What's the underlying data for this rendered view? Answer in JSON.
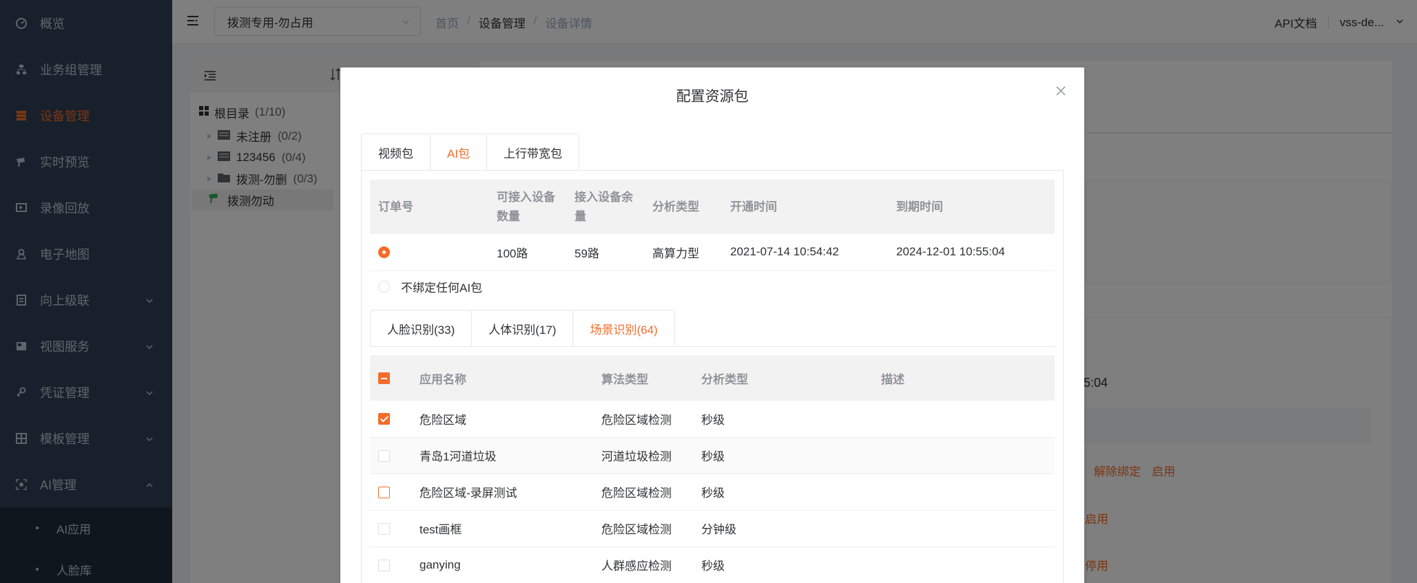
{
  "sidebar": {
    "items": [
      {
        "label": "概览",
        "icon": "dashboard-icon"
      },
      {
        "label": "业务组管理",
        "icon": "org-icon"
      },
      {
        "label": "设备管理",
        "icon": "device-icon",
        "active": true
      },
      {
        "label": "实时预览",
        "icon": "camera-icon"
      },
      {
        "label": "录像回放",
        "icon": "playback-icon"
      },
      {
        "label": "电子地图",
        "icon": "map-icon"
      },
      {
        "label": "向上级联",
        "icon": "cascade-icon",
        "expandable": true
      },
      {
        "label": "视图服务",
        "icon": "view-icon",
        "expandable": true
      },
      {
        "label": "凭证管理",
        "icon": "key-icon",
        "expandable": true
      },
      {
        "label": "模板管理",
        "icon": "template-icon",
        "expandable": true
      },
      {
        "label": "AI管理",
        "icon": "ai-icon",
        "expanded": true
      }
    ],
    "subitems": [
      {
        "label": "AI应用"
      },
      {
        "label": "人脸库"
      }
    ]
  },
  "header": {
    "select_value": "拨测专用-勿占用",
    "breadcrumb": [
      "首页",
      "设备管理",
      "设备详情"
    ],
    "api_doc": "API文档",
    "user": "vss-de..."
  },
  "tree": {
    "root_label": "根目录",
    "root_count": "(1/10)",
    "nodes": [
      {
        "label": "未注册",
        "count": "(0/2)"
      },
      {
        "label": "123456",
        "count": "(0/4)"
      },
      {
        "label": "拨测-勿删",
        "count": "(0/3)"
      },
      {
        "label": "拨测勿动",
        "count": ""
      }
    ]
  },
  "background": {
    "time_fragment": "5:04",
    "actions_row1": [
      "解除绑定",
      "启用"
    ],
    "actions_row2": [
      "启用"
    ],
    "actions_row3": [
      "停用"
    ]
  },
  "dialog": {
    "title": "配置资源包",
    "outer_tabs": [
      "视频包",
      "AI包",
      "上行带宽包"
    ],
    "active_outer_tab": 1,
    "pkg_table": {
      "headers": [
        "订单号",
        "可接入设备数量",
        "接入设备余量",
        "分析类型",
        "开通时间",
        "到期时间"
      ],
      "rows": [
        {
          "order": "",
          "capacity": "100路",
          "remaining": "59路",
          "type": "高算力型",
          "start": "2021-07-14 10:54:42",
          "end": "2024-12-01 10:55:04"
        }
      ]
    },
    "no_bind_label": "不绑定任何AI包",
    "inner_tabs": [
      "人脸识别(33)",
      "人体识别(17)",
      "场景识别(64)"
    ],
    "active_inner_tab": 2,
    "app_table": {
      "headers": [
        "应用名称",
        "算法类型",
        "分析类型",
        "描述"
      ],
      "rows": [
        {
          "name": "危险区域",
          "algo": "危险区域检测",
          "type": "秒级",
          "desc": "",
          "checked": true
        },
        {
          "name": "青岛1河道垃圾",
          "algo": "河道垃圾检测",
          "type": "秒级",
          "desc": "",
          "checked": false
        },
        {
          "name": "危险区域-录屏测试",
          "algo": "危险区域检测",
          "type": "秒级",
          "desc": "",
          "checked": false
        },
        {
          "name": "test画框",
          "algo": "危险区域检测",
          "type": "分钟级",
          "desc": "",
          "checked": false
        },
        {
          "name": "ganying",
          "algo": "人群感应检测",
          "type": "秒级",
          "desc": "",
          "checked": false
        }
      ]
    }
  },
  "colors": {
    "accent": "#f56c2a",
    "sidebar_bg": "#304156",
    "submenu_bg": "#1f2d3d"
  }
}
